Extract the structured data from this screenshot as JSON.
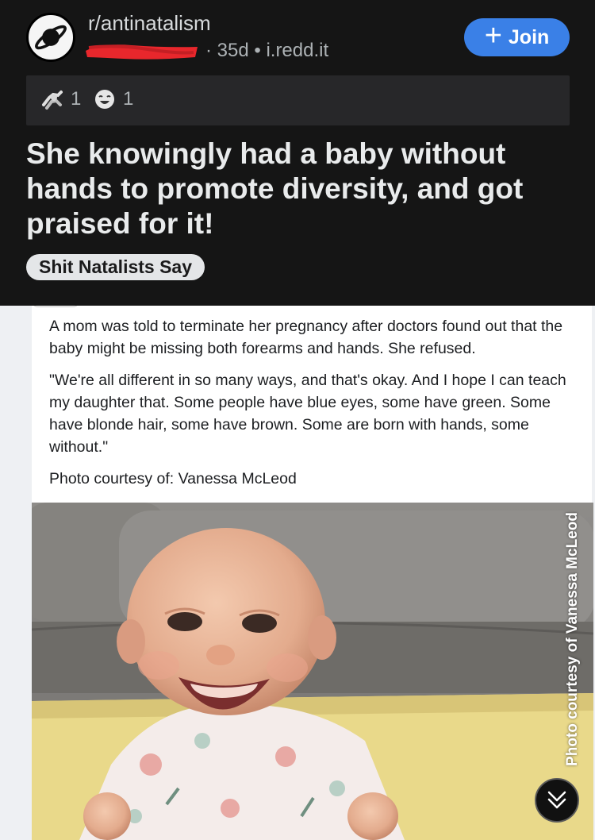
{
  "post": {
    "subreddit": "r/antinatalism",
    "age_and_domain": "· 35d • i.redd.it",
    "join_label": "Join",
    "join_plus": "+",
    "awards": [
      {
        "icon": "arm-wrestle-award-icon",
        "count": "1"
      },
      {
        "icon": "laughing-face-award-icon",
        "count": "1"
      }
    ],
    "title": "She knowingly had a baby without hands to promote diversity, and got praised for it!",
    "flair": "Shit Natalists Say"
  },
  "image": {
    "caption_1": "A mom was told to terminate her pregnancy after doctors found out that the baby might be missing both forearms and hands. She refused.",
    "caption_2": "\"We're all different in so many ways, and that's okay. And I hope I can teach my daughter that. Some people have blue eyes, some have green. Some have blonde hair, some have brown. Some are born with hands, some without.\"",
    "caption_3": "Photo courtesy of: Vanessa McLeod",
    "watermark": "Photo courtesy of Vanessa McLeod",
    "photo_subject": "smiling baby sitting on a grey couch"
  },
  "colors": {
    "header_bg": "#151515",
    "join_blue": "#3a80e7",
    "redaction_red": "#e8272c"
  },
  "controls": {
    "scroll_down_icon": "double-chevron-down-icon"
  }
}
